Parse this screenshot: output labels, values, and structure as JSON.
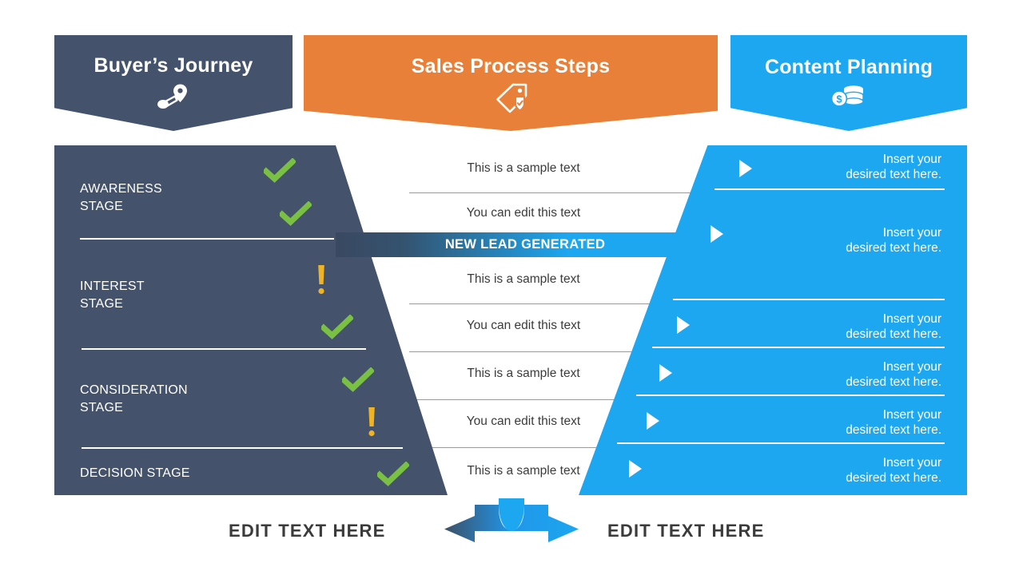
{
  "headers": [
    {
      "title": "Buyer’s Journey",
      "icon": "route-location-pin-icon",
      "color": "#44536B"
    },
    {
      "title": "Sales Process Steps",
      "icon": "tag-shield-check-icon",
      "color": "#E8803A"
    },
    {
      "title": "Content Planning",
      "icon": "coins-dollar-icon",
      "color": "#1CA7F0"
    }
  ],
  "funnel": {
    "color": "#44536B",
    "stages": [
      {
        "label": "AWARENESS\nSTAGE"
      },
      {
        "label": "INTEREST\nSTAGE"
      },
      {
        "label": "CONSIDERATION\nSTAGE"
      },
      {
        "label": "DECISION STAGE"
      }
    ],
    "marks": [
      {
        "type": "check-icon",
        "color": "#7AC143"
      },
      {
        "type": "check-icon",
        "color": "#7AC143"
      },
      {
        "type": "exclamation-icon",
        "color": "#F0B323"
      },
      {
        "type": "check-icon",
        "color": "#7AC143"
      },
      {
        "type": "check-icon",
        "color": "#7AC143"
      },
      {
        "type": "exclamation-icon",
        "color": "#F0B323"
      },
      {
        "type": "check-icon",
        "color": "#7AC143"
      }
    ]
  },
  "center": {
    "rows": [
      {
        "text": "This is a sample text"
      },
      {
        "text": "You can edit this text"
      },
      {
        "text": "This is a sample text"
      },
      {
        "text": "You can edit this text"
      },
      {
        "text": "This is a sample text"
      },
      {
        "text": "You can edit this text"
      },
      {
        "text": "This is a sample text"
      }
    ],
    "lead_band": {
      "text": "NEW LEAD GENERATED"
    }
  },
  "right": {
    "color": "#1CA7F0",
    "rows": [
      {
        "text": "Insert your\ndesired text here.",
        "bullet": "play-triangle-icon"
      },
      {
        "text": "Insert your\ndesired text here.",
        "bullet": "play-triangle-icon"
      },
      {
        "text": "Insert your\ndesired text here.",
        "bullet": "play-triangle-icon"
      },
      {
        "text": "Insert your\ndesired text here.",
        "bullet": "play-triangle-icon"
      },
      {
        "text": "Insert your\ndesired text here.",
        "bullet": "play-triangle-icon"
      },
      {
        "text": "Insert your\ndesired text here.",
        "bullet": "play-triangle-icon"
      }
    ]
  },
  "bottom": {
    "left_label": "EDIT TEXT HERE",
    "right_label": "EDIT TEXT HERE",
    "arrow": "split-two-way-arrow-icon",
    "arrow_left_color": "#3C5068",
    "arrow_right_color": "#1CA7F0"
  },
  "palette": {
    "dark": "#44536B",
    "orange": "#E8803A",
    "blue": "#1CA7F0",
    "green": "#7AC143",
    "amber": "#F0B323",
    "text": "#3b3b3b",
    "separator": "#9a9a9a"
  }
}
